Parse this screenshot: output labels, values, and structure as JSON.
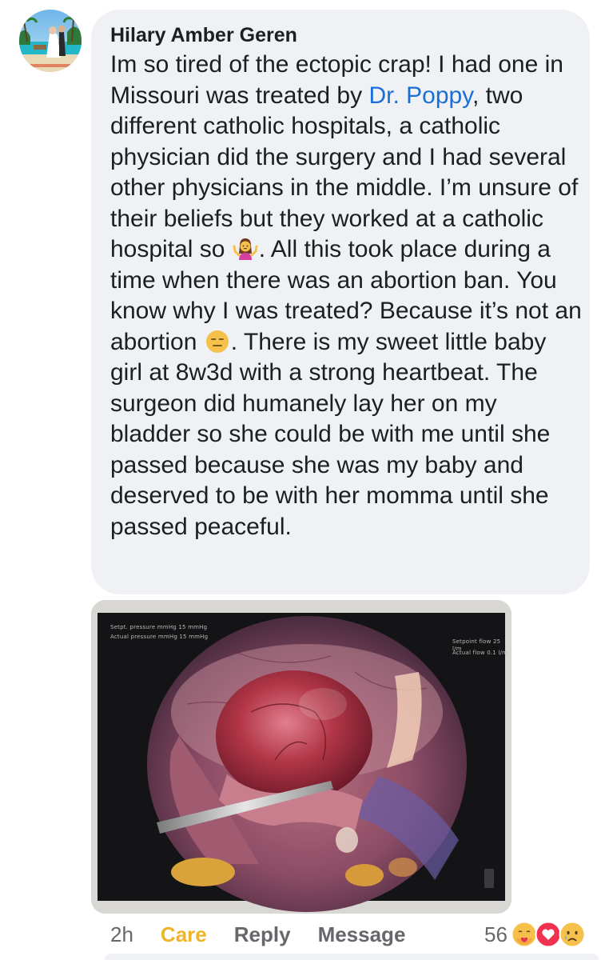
{
  "comment": {
    "author": "Hilary Amber Geren",
    "text_before_mention": "Im so tired of the ectopic crap! I had one in Missouri was treated by ",
    "mention": "Dr. Poppy",
    "text_part2": ", two different catholic hospitals, a catholic physician did the surgery and I had several other physicians in the middle.  I’m unsure of their beliefs but they worked at a catholic hospital so ",
    "emoji_1": "woman-shrugging-emoji",
    "text_part3": ". All this took place during a time when there was an abortion ban.  You know why I was treated? Because it’s not an abortion ",
    "emoji_2": "expressionless-face-emoji",
    "text_part4": ".  There is my sweet little baby girl at 8w3d with a strong heartbeat.  The surgeon did humanely lay her on my bladder so she could be with me until she passed because she was my baby and deserved to be with her momma until she passed peaceful."
  },
  "photo": {
    "overlay_top_left_1": "Setpt. pressure mmHg 15 mmHg",
    "overlay_top_left_2": "Actual pressure mmHg 15 mmHg",
    "overlay_top_right_1": "Setpoint flow 25 l/m",
    "overlay_top_right_2": "Actual flow 0.1 l/m"
  },
  "actions": {
    "time": "2h",
    "care": "Care",
    "reply": "Reply",
    "message": "Message"
  },
  "reactions": {
    "count": "56",
    "icons": [
      "care-reaction-icon",
      "love-reaction-icon",
      "sad-reaction-icon"
    ]
  },
  "colors": {
    "bubble": "#eff1f5",
    "mention": "#1a6ed8",
    "care": "#f0b42a",
    "secondary_text": "#65676b"
  }
}
